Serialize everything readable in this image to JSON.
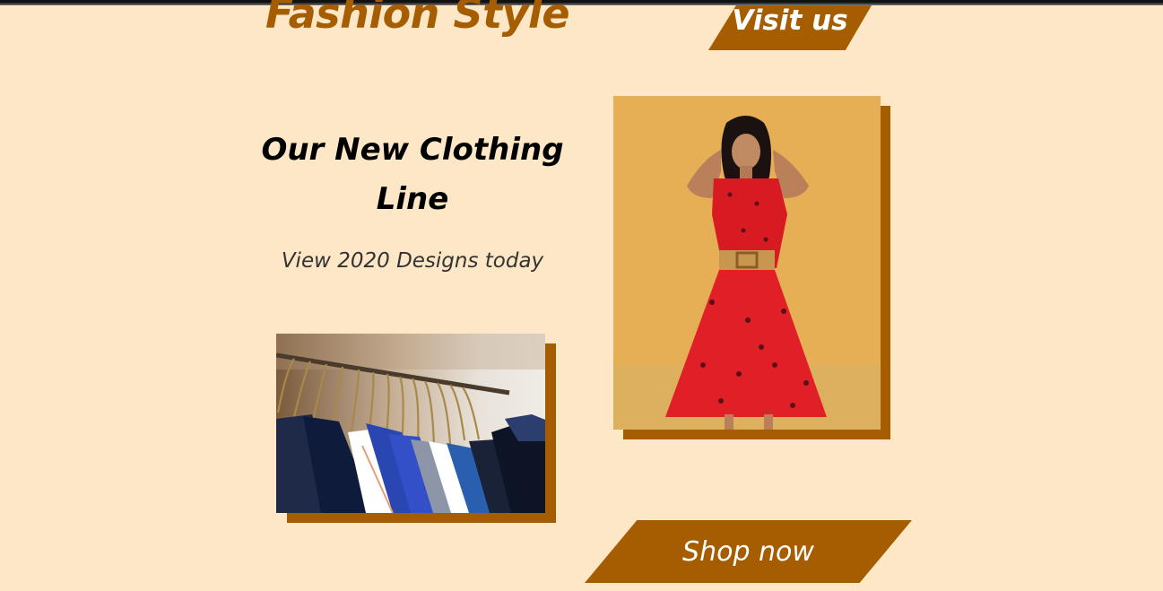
{
  "header": {
    "brand": "Fashion Style",
    "visit_label": "Visit us"
  },
  "hero": {
    "headline_line1": "Our New Clothing",
    "headline_line2": "Line",
    "subline": "View 2020 Designs today",
    "shop_label": "Shop now"
  },
  "images": {
    "rack_alt": "clothing rack photo",
    "model_alt": "model in red dress photo"
  },
  "colors": {
    "background": "#fde7c7",
    "accent": "#a55d00"
  }
}
